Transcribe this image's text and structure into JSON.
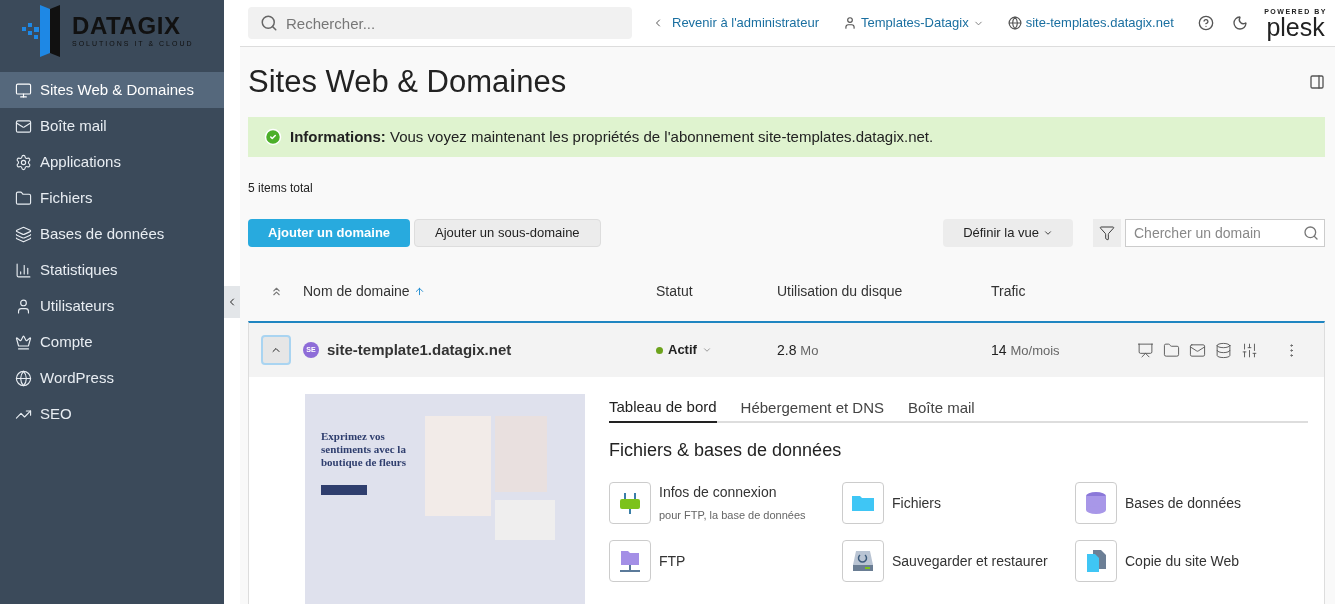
{
  "logo": {
    "name": "DATAGIX",
    "tagline": "SOLUTIONS IT & CLOUD"
  },
  "sidebar": {
    "items": [
      {
        "label": "Sites Web & Domaines",
        "selected": true
      },
      {
        "label": "Boîte mail",
        "selected": false
      },
      {
        "label": "Applications",
        "selected": false
      },
      {
        "label": "Fichiers",
        "selected": false
      },
      {
        "label": "Bases de données",
        "selected": false
      },
      {
        "label": "Statistiques",
        "selected": false
      },
      {
        "label": "Utilisateurs",
        "selected": false
      },
      {
        "label": "Compte",
        "selected": false
      },
      {
        "label": "WordPress",
        "selected": false
      },
      {
        "label": "SEO",
        "selected": false
      }
    ]
  },
  "topbar": {
    "search": {
      "placeholder": "Rechercher..."
    },
    "back_link": "Revenir à l'administrateur",
    "user": "Templates-Datagix",
    "site": "site-templates.datagix.net",
    "brand": {
      "powered": "POWERED BY",
      "name": "plesk"
    }
  },
  "page": {
    "title": "Sites Web & Domaines",
    "info": "**Informations:** Vous voyez maintenant les propriétés de l'abonnement site-templates.datagix.net.",
    "items_total": "5 items total"
  },
  "toolbar": {
    "add_domain": "Ajouter un domaine",
    "add_subdomain": "Ajouter un sous-domaine",
    "view": "Définir la vue",
    "search": {
      "placeholder": "Chercher un domain"
    }
  },
  "table": {
    "columns": [
      {
        "label": "Nom de domaine",
        "sorted": true
      },
      {
        "label": "Statut",
        "sorted": false
      },
      {
        "label": "Utilisation du disque",
        "sorted": false
      },
      {
        "label": "Trafic",
        "sorted": false
      }
    ],
    "rows": [
      {
        "expanded": true,
        "badge": "SE",
        "name": "site-template1.datagix.net",
        "status": "Actif",
        "active": true,
        "disk": "2.8",
        "disk_unit": "Mo",
        "traffic": "14",
        "traffic_unit": "Mo/mois"
      }
    ]
  },
  "details": {
    "preview": {
      "heading": "Exprimez vos sentiments avec la boutique de fleurs"
    },
    "tabs": [
      {
        "label": "Tableau de bord",
        "selected": true
      },
      {
        "label": "Hébergement et DNS",
        "selected": false
      },
      {
        "label": "Boîte mail",
        "selected": false
      }
    ],
    "section_title": "Fichiers & bases de données",
    "tiles": [
      {
        "kind": "plug",
        "label": "Infos de connexion",
        "sub": "pour FTP, la base de données"
      },
      {
        "kind": "folder",
        "label": "Fichiers"
      },
      {
        "kind": "database",
        "label": "Bases de données"
      },
      {
        "kind": "ftp",
        "label": "FTP"
      },
      {
        "kind": "backup",
        "label": "Sauvegarder et restaurer"
      },
      {
        "kind": "copy",
        "label": "Copie du site Web"
      }
    ]
  }
}
